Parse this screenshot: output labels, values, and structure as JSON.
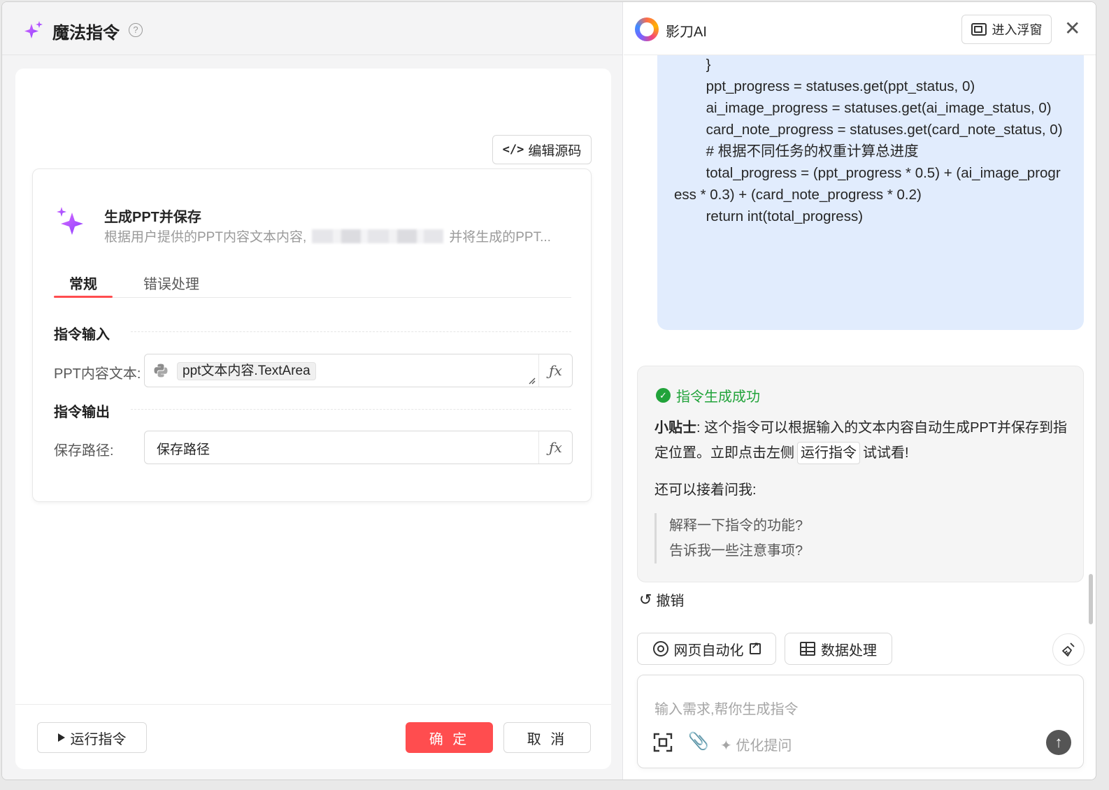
{
  "left": {
    "title": "魔法指令",
    "help_icon": "?",
    "edit_source_label": "编辑源码",
    "command": {
      "title": "生成PPT并保存",
      "desc_start": "根据用户提供的PPT内容文本内容,",
      "desc_end": "并将生成的PPT..."
    },
    "tabs": [
      {
        "label": "常规",
        "active": true
      },
      {
        "label": "错误处理",
        "active": false
      }
    ],
    "input_section": "指令输入",
    "output_section": "指令输出",
    "ppt_field": {
      "label": "PPT内容文本:",
      "value": "ppt文本内容.TextArea"
    },
    "path_field": {
      "label": "保存路径:",
      "value": "保存路径"
    },
    "fx": "ƒx",
    "footer": {
      "run_label": "运行指令",
      "ok_label": "确 定",
      "cancel_label": "取 消"
    }
  },
  "right": {
    "app_name": "影刀AI",
    "float_label": "进入浮窗",
    "code_lines": [
      "        }",
      "",
      "        ppt_progress = statuses.get(ppt_status, 0)",
      "        ai_image_progress = statuses.get(ai_image_status, 0)",
      "        card_note_progress = statuses.get(card_note_status, 0)",
      "",
      "        # 根据不同任务的权重计算总进度",
      "        total_progress = (ppt_progress * 0.5) + (ai_image_progress * 0.3) + (card_note_progress * 0.2)",
      "        return int(total_progress)"
    ],
    "success_text": "指令生成成功",
    "tip": {
      "bold": "小贴士",
      "text1": ": 这个指令可以根据输入的文本内容自动生成PPT并保存到指定位置。立即点击左侧",
      "kbd": "运行指令",
      "text2": "试试看!"
    },
    "ask_more": "还可以接着问我:",
    "suggestions": [
      "解释一下指令的功能?",
      "告诉我一些注意事项?"
    ],
    "undo_label": "撤销",
    "chips": [
      {
        "label": "网页自动化"
      },
      {
        "label": "数据处理"
      }
    ],
    "input_placeholder": "输入需求,帮你生成指令",
    "optimize_label": "优化提问"
  },
  "colors": {
    "accent_red": "#ff4d4f",
    "success_green": "#21a33a",
    "bubble_blue": "#e1ecfd",
    "sparkle_purple": "#b04dff"
  }
}
